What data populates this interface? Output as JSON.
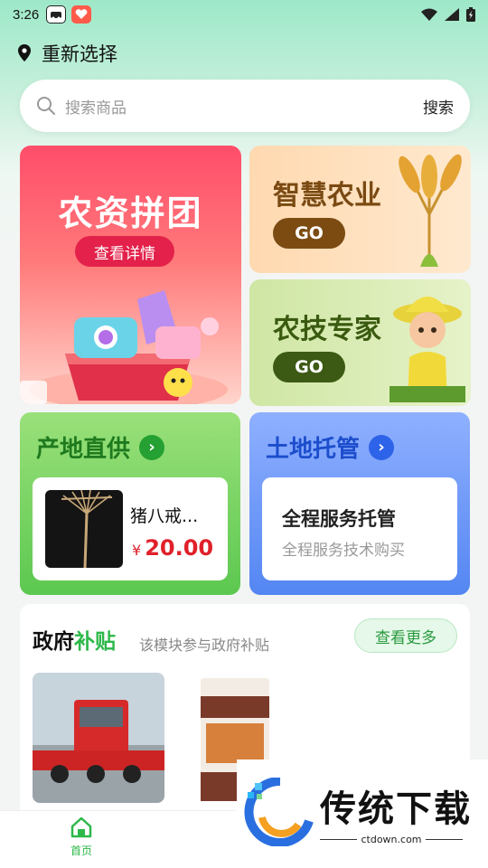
{
  "status_bar": {
    "time": "3:26"
  },
  "location": {
    "label": "重新选择"
  },
  "search": {
    "placeholder": "搜索商品",
    "button": "搜索"
  },
  "banners": {
    "group_buy": {
      "title": "农资拼团",
      "button": "查看详情"
    },
    "smart_agri": {
      "title": "智慧农业",
      "button": "GO"
    },
    "agri_expert": {
      "title": "农技专家",
      "button": "GO"
    }
  },
  "origin_supply": {
    "title": "产地直供",
    "product": {
      "name": "猪八戒...",
      "currency": "¥",
      "price": "20.00"
    }
  },
  "land_trust": {
    "title": "土地托管",
    "headline": "全程服务托管",
    "subtitle": "全程服务技术购买"
  },
  "gov_subsidy": {
    "title_a": "政府",
    "title_b": "补贴",
    "subtitle": "该模块参与政府补贴",
    "more": "查看更多"
  },
  "tabbar": {
    "items": [
      {
        "label": "首页",
        "active": true
      }
    ]
  },
  "watermark": {
    "text": "传统下载",
    "domain": "ctdown.com"
  },
  "colors": {
    "accent": "#2db84a",
    "price": "#e0202a"
  }
}
